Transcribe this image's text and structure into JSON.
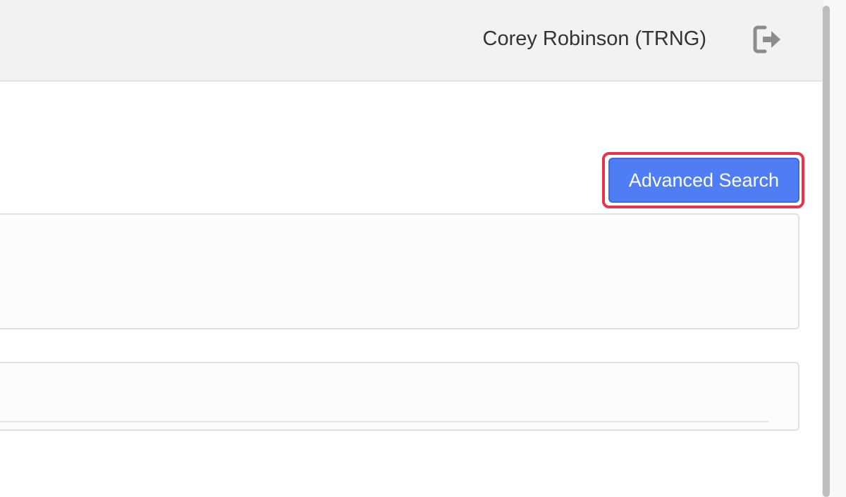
{
  "header": {
    "user_name": "Corey Robinson (TRNG)",
    "logout_icon": "logout-icon"
  },
  "toolbar": {
    "advanced_search_label": "Advanced Search"
  },
  "colors": {
    "primary_button": "#4e7df5",
    "highlight": "#e8344a",
    "header_bg": "#f2f2f2",
    "icon_gray": "#8c8c8c"
  }
}
